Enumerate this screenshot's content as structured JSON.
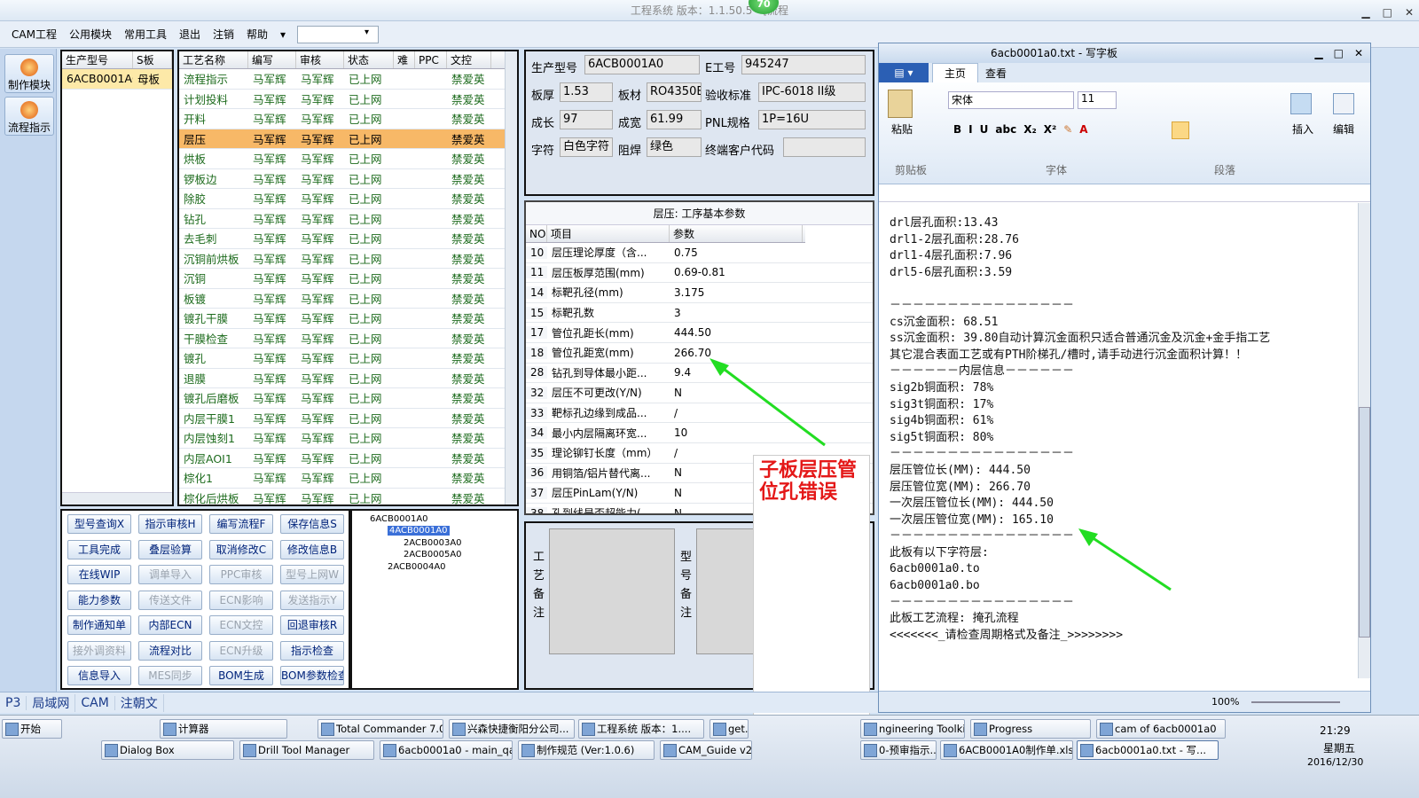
{
  "window": {
    "title": "工程系统  版本：1.1.50.5 - [流程",
    "badge": "70"
  },
  "menu": [
    "CAM工程",
    "公用模块",
    "常用工具",
    "退出",
    "注销",
    "帮助"
  ],
  "leftnav": [
    {
      "label": "制作模块"
    },
    {
      "label": "流程指示"
    }
  ],
  "prodtable": {
    "headers": [
      "生产型号",
      "S板"
    ],
    "rows": [
      [
        "6ACB0001A0",
        "母板"
      ]
    ]
  },
  "proctable": {
    "headers": [
      "工艺名称",
      "编写",
      "审核",
      "状态",
      "难",
      "PPC",
      "文控"
    ],
    "rows": [
      [
        "流程指示",
        "马军辉",
        "马军辉",
        "已上网",
        "",
        "",
        "禁爱英"
      ],
      [
        "计划投料",
        "马军辉",
        "马军辉",
        "已上网",
        "",
        "",
        "禁爱英"
      ],
      [
        "开料",
        "马军辉",
        "马军辉",
        "已上网",
        "",
        "",
        "禁爱英"
      ],
      [
        "层压",
        "马军辉",
        "马军辉",
        "已上网",
        "",
        "",
        "禁爱英"
      ],
      [
        "烘板",
        "马军辉",
        "马军辉",
        "已上网",
        "",
        "",
        "禁爱英"
      ],
      [
        "锣板边",
        "马军辉",
        "马军辉",
        "已上网",
        "",
        "",
        "禁爱英"
      ],
      [
        "除胶",
        "马军辉",
        "马军辉",
        "已上网",
        "",
        "",
        "禁爱英"
      ],
      [
        "钻孔",
        "马军辉",
        "马军辉",
        "已上网",
        "",
        "",
        "禁爱英"
      ],
      [
        "去毛刺",
        "马军辉",
        "马军辉",
        "已上网",
        "",
        "",
        "禁爱英"
      ],
      [
        "沉铜前烘板",
        "马军辉",
        "马军辉",
        "已上网",
        "",
        "",
        "禁爱英"
      ],
      [
        "沉铜",
        "马军辉",
        "马军辉",
        "已上网",
        "",
        "",
        "禁爱英"
      ],
      [
        "板镀",
        "马军辉",
        "马军辉",
        "已上网",
        "",
        "",
        "禁爱英"
      ],
      [
        "镀孔干膜",
        "马军辉",
        "马军辉",
        "已上网",
        "",
        "",
        "禁爱英"
      ],
      [
        "干膜检查",
        "马军辉",
        "马军辉",
        "已上网",
        "",
        "",
        "禁爱英"
      ],
      [
        "镀孔",
        "马军辉",
        "马军辉",
        "已上网",
        "",
        "",
        "禁爱英"
      ],
      [
        "退膜",
        "马军辉",
        "马军辉",
        "已上网",
        "",
        "",
        "禁爱英"
      ],
      [
        "镀孔后磨板",
        "马军辉",
        "马军辉",
        "已上网",
        "",
        "",
        "禁爱英"
      ],
      [
        "内层干膜1",
        "马军辉",
        "马军辉",
        "已上网",
        "",
        "",
        "禁爱英"
      ],
      [
        "内层蚀刻1",
        "马军辉",
        "马军辉",
        "已上网",
        "",
        "",
        "禁爱英"
      ],
      [
        "内层AOI1",
        "马军辉",
        "马军辉",
        "已上网",
        "",
        "",
        "禁爱英"
      ],
      [
        "棕化1",
        "马军辉",
        "马军辉",
        "已上网",
        "",
        "",
        "禁爱英"
      ],
      [
        "棕化后烘板",
        "马军辉",
        "马军辉",
        "已上网",
        "",
        "",
        "禁爱英"
      ]
    ],
    "selected_index": 3
  },
  "buttons": [
    [
      "型号查询X",
      "指示审核H",
      "编写流程F",
      "保存信息S"
    ],
    [
      "工具完成",
      "叠层验算",
      "取消修改C",
      "修改信息B"
    ],
    [
      "在线WIP",
      "调单导入",
      "PPC审核",
      "型号上网W"
    ],
    [
      "能力参数",
      "传送文件",
      "ECN影响",
      "发送指示Y"
    ],
    [
      "制作通知单",
      "内部ECN",
      "ECN文控",
      "回退审核R"
    ],
    [
      "接外调资料",
      "流程对比",
      "ECN升级",
      "指示检查"
    ],
    [
      "信息导入",
      "MES同步",
      "BOM生成",
      "BOM参数检查"
    ]
  ],
  "disabled_buttons": [
    "调单导入",
    "PPC审核",
    "型号上网W",
    "传送文件",
    "ECN影响",
    "发送指示Y",
    "ECN文控",
    "接外调资料",
    "ECN升级",
    "MES同步"
  ],
  "tree": [
    "6ACB0001A0",
    "4ACB0001A0",
    "2ACB0003A0",
    "2ACB0005A0",
    "2ACB0004A0"
  ],
  "info": {
    "prod_label": "生产型号",
    "prod_val": "6ACB0001A0",
    "e_label": "E工号",
    "e_val": "945247",
    "thick_label": "板厚",
    "thick_val": "1.53",
    "mat_label": "板材",
    "mat_val": "RO4350B",
    "std_label": "验收标准",
    "std_val": "IPC-6018 II级",
    "grow_label": "成长",
    "grow_val": "97",
    "finish_label": "成宽",
    "finish_val": "61.99",
    "pnl_label": "PNL规格",
    "pnl_val": "1P=16U",
    "char_label": "字符",
    "char_val": "白色字符",
    "mask_label": "阻焊",
    "mask_val": "绿色",
    "cust_label": "终端客户代码",
    "cust_val": ""
  },
  "params": {
    "title": "层压: 工序基本参数",
    "headers": [
      "NO",
      "项目",
      "参数"
    ],
    "rows": [
      [
        "10",
        "层压理论厚度（含...",
        "0.75"
      ],
      [
        "11",
        "层压板厚范围(mm)",
        "0.69-0.81"
      ],
      [
        "14",
        "标靶孔径(mm)",
        "3.175"
      ],
      [
        "15",
        "标靶孔数",
        "3"
      ],
      [
        "17",
        "管位孔距长(mm)",
        "444.50"
      ],
      [
        "18",
        "管位孔距宽(mm)",
        "266.70"
      ],
      [
        "28",
        "钻孔到导体最小距...",
        "9.4"
      ],
      [
        "32",
        "层压不可更改(Y/N)",
        "N"
      ],
      [
        "33",
        "靶标孔边缘到成品...",
        "/"
      ],
      [
        "34",
        "最小内层隔离环宽...",
        "10"
      ],
      [
        "35",
        "理论铆钉长度（mm）",
        "/"
      ],
      [
        "36",
        "用铜箔/铝片替代离...",
        "N"
      ],
      [
        "37",
        "层压PinLam(Y/N)",
        "N"
      ],
      [
        "38",
        "孔到线是否超能力(...",
        "N"
      ]
    ]
  },
  "notes": {
    "proc_label": "工艺备注",
    "model_label": "型号备注"
  },
  "annotation": "子板层压管位孔错误",
  "wordpad": {
    "title": "6acb0001a0.txt - 写字板",
    "tab_home": "主页",
    "tab_view": "查看",
    "font": "宋体",
    "size": "11",
    "paste": "粘贴",
    "clipboard": "剪贴板",
    "font_group": "字体",
    "para_group": "段落",
    "insert": "插入",
    "edit": "编辑",
    "zoom": "100%",
    "lines": [
      "drl层孔面积:13.43",
      "drl1-2层孔面积:28.76",
      "drl1-4层孔面积:7.96",
      "drl5-6层孔面积:3.59",
      "",
      "－－－－－－－－－－－－－－－－",
      "cs沉金面积: 68.51",
      "ss沉金面积: 39.80自动计算沉金面积只适合普通沉金及沉金+金手指工艺",
      "其它混合表面工艺或有PTH阶梯孔/槽时,请手动进行沉金面积计算！！",
      "－－－－－－内层信息－－－－－－",
      "sig2b铜面积: 78%",
      "sig3t铜面积: 17%",
      "sig4b铜面积: 61%",
      "sig5t铜面积: 80%",
      "－－－－－－－－－－－－－－－－",
      "层压管位长(MM): 444.50",
      "层压管位宽(MM): 266.70",
      "一次层压管位长(MM): 444.50",
      "一次层压管位宽(MM): 165.10",
      "－－－－－－－－－－－－－－－－",
      "此板有以下字符层:",
      "6acb0001a0.to",
      "6acb0001a0.bo",
      "－－－－－－－－－－－－－－－－",
      "此板工艺流程: 掩孔流程",
      "<<<<<<<_请检查周期格式及备注_>>>>>>>>"
    ]
  },
  "bottomtabs": [
    "P3",
    "局域网",
    "CAM",
    "注朝文"
  ],
  "taskbar": {
    "start": "开始",
    "row1": [
      "计算器",
      "Total Commander 7.0 ...",
      "兴森快捷衡阳分公司...",
      "工程系统  版本：1....",
      "get.e",
      "ngineering Toolkit 9....",
      "Progress",
      "cam of 6acb0001a0"
    ],
    "row2": [
      "Dialog Box",
      "Drill Tool Manager",
      "6acb0001a0 - main_qa",
      "制作规范 (Ver:1.0.6)",
      "CAM_Guide v2.7",
      "0-预审指示....",
      "6ACB0001A0制作单.xls ...",
      "6acb0001a0.txt - 写..."
    ],
    "time": "21:29",
    "day": "星期五",
    "date": "2016/12/30"
  }
}
